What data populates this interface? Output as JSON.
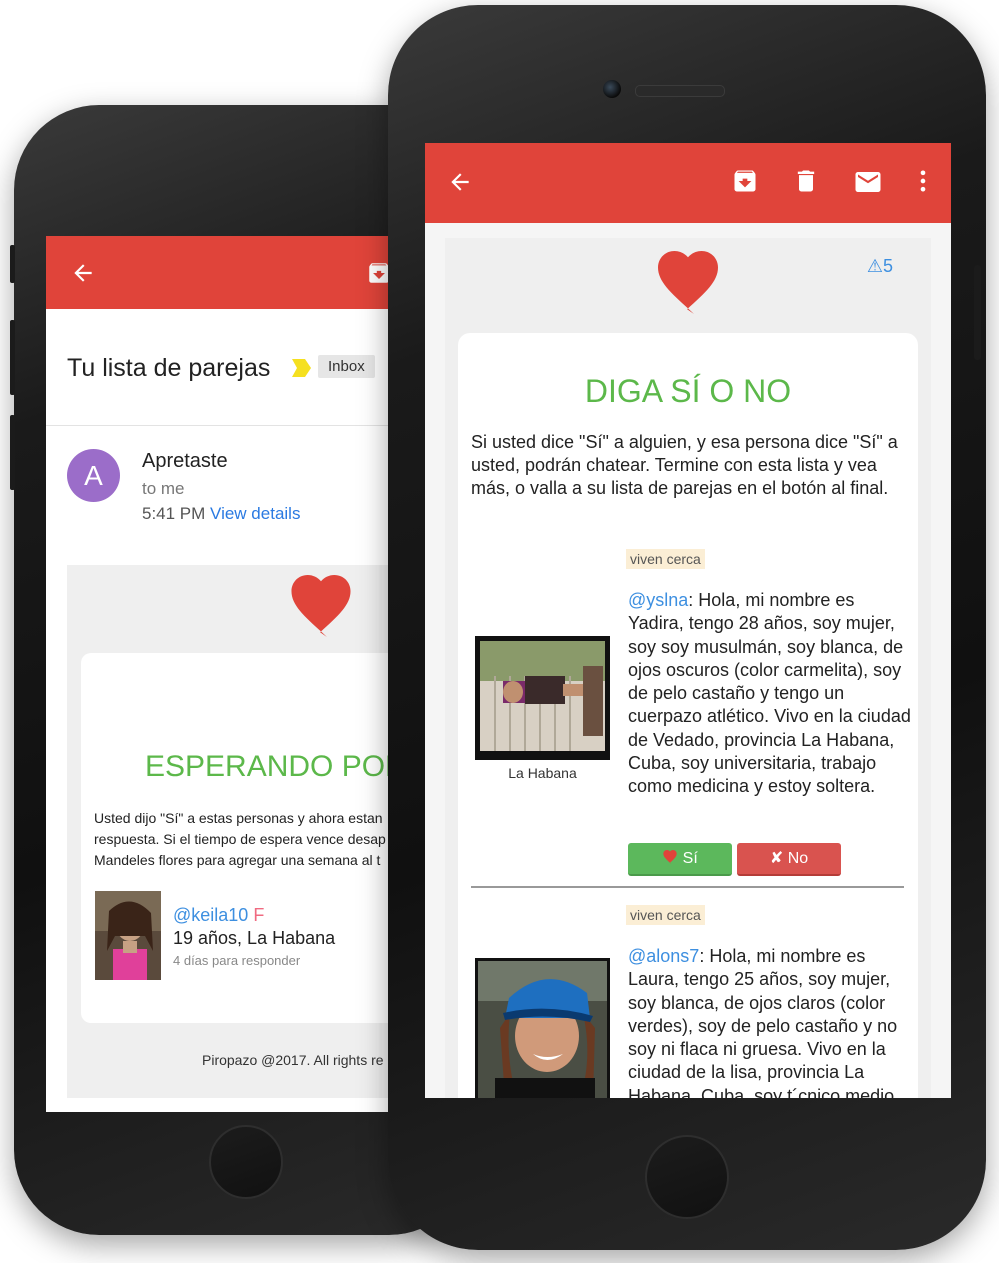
{
  "back": {
    "subject": "Tu lista de parejas",
    "label": "Inbox",
    "avatar_letter": "A",
    "sender": "Apretaste",
    "recipient": "to me",
    "time": "5:41 PM",
    "view_details": "View details",
    "title": "ESPERANDO POR",
    "body_lines": [
      "Usted dijo \"Sí\" a estas personas y ahora estan",
      "respuesta. Si el tiempo de espera vence desap",
      "Mandeles flores para agregar una semana al t"
    ],
    "match": {
      "username": "@keila10",
      "gender": "F",
      "details": "19 años, La Habana",
      "deadline": "4 días para responder"
    },
    "footer": "Piropazo @2017. All rights re"
  },
  "front": {
    "warnings": "⚠5",
    "title": "DIGA SÍ O NO",
    "intro": "Si usted dice \"Sí\" a alguien, y esa persona dice \"Sí\" a usted, podrán chatear. Termine con esta lista y vea más, o valla a su lista de parejas en el botón al final.",
    "profiles": [
      {
        "tag": "viven cerca",
        "username": "@yslna",
        "text": ": Hola, mi nombre es Yadira, tengo 28 años, soy mujer, soy soy musulmán, soy blanca, de ojos oscuros (color carmelita), soy de pelo castaño y tengo un cuerpazo atlético. Vivo en la ciudad de Vedado, provincia La Habana, Cuba, soy universitaria, trabajo como medicina y estoy soltera.",
        "city": "La Habana",
        "yes_label": "Sí",
        "no_label": "No"
      },
      {
        "tag": "viven cerca",
        "username": "@alons7",
        "text": ": Hola, mi nombre es Laura, tengo 25 años, soy mujer, soy blanca, de ojos claros (color verdes), soy de pelo castaño y no soy ni flaca ni gruesa. Vivo en la ciudad de la lisa, provincia La Habana, Cuba, soy t´cnico medio"
      }
    ]
  },
  "colors": {
    "appbar": "#e0443a",
    "title_green": "#5cb84a",
    "link_blue": "#3d8fe0",
    "yes_green": "#5cb85c",
    "no_red": "#d9534f"
  }
}
